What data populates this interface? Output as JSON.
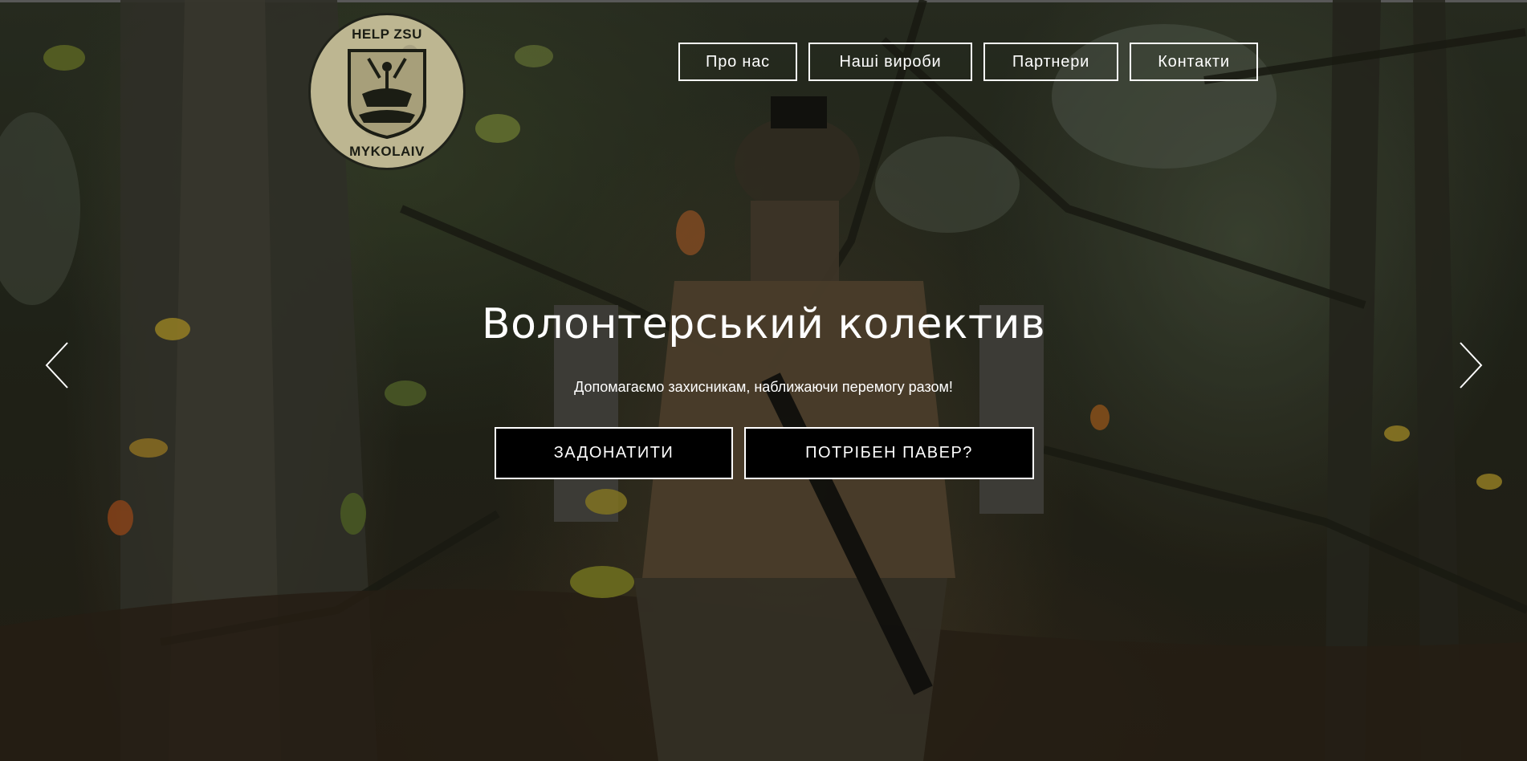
{
  "logo": {
    "text_top": "HELP ZSU",
    "text_bottom": "MYKOLAIV"
  },
  "nav": {
    "items": [
      {
        "label": "Про нас"
      },
      {
        "label": "Наші вироби"
      },
      {
        "label": "Партнери"
      },
      {
        "label": "Контакти"
      }
    ]
  },
  "hero": {
    "title": "Волонтерський колектив",
    "subtitle": "Допомагаємо захисникам, наближаючи перемогу разом!",
    "buttons": {
      "donate": "ЗАДОНАТИТИ",
      "power": "ПОТРІБЕН ПАВЕР?"
    }
  },
  "carousel": {
    "prev_icon": "chevron-left-icon",
    "next_icon": "chevron-right-icon"
  },
  "colors": {
    "text": "#ffffff",
    "button_bg": "#000000",
    "border": "#ffffff"
  }
}
